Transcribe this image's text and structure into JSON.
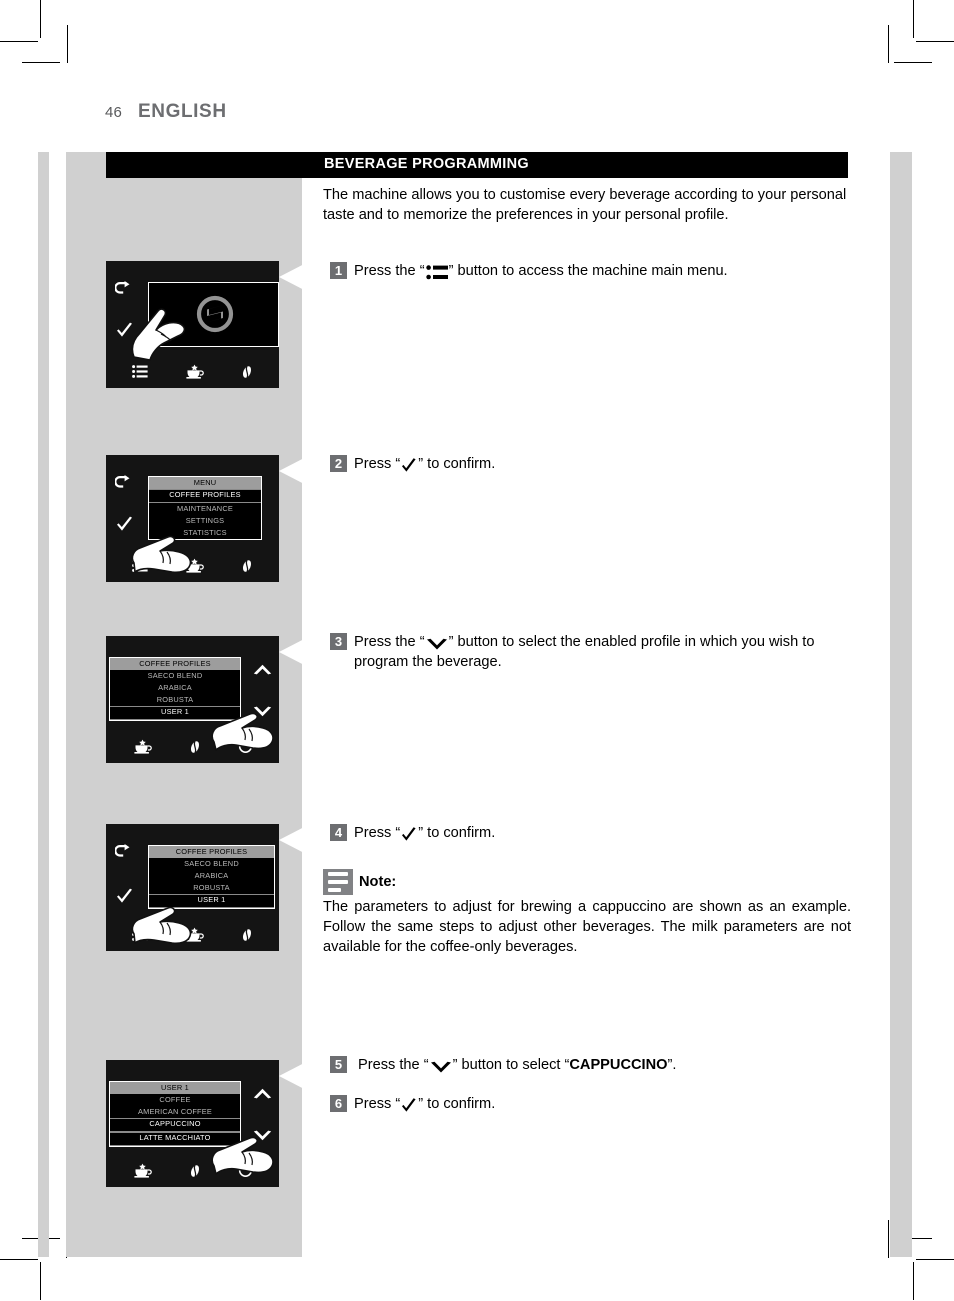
{
  "header": {
    "page_number": "46",
    "language": "ENGLISH"
  },
  "section": {
    "title": "BEVERAGE PROGRAMMING",
    "intro": "The machine allows you to customise every beverage according to your personal taste and to memorize the preferences in your personal profile."
  },
  "steps": [
    {
      "num": "1",
      "pre": "Press the “",
      "icon": "menu-lines-icon",
      "post": "” button to access the machine main menu."
    },
    {
      "num": "2",
      "pre": "Press “",
      "icon": "check-icon",
      "post": "” to confirm."
    },
    {
      "num": "3",
      "pre": "Press the “",
      "icon": "chevron-down-icon",
      "post": "” button to select the enabled profile in which you wish to program the beverage."
    },
    {
      "num": "4",
      "pre": "Press “",
      "icon": "check-icon",
      "post": "” to confirm."
    },
    {
      "num": "5",
      "pre": "Press the “",
      "icon": "chevron-down-icon",
      "post": "” button to select “",
      "emphasis": "CAPPUCCINO",
      "tail": "”."
    },
    {
      "num": "6",
      "pre": "Press “",
      "icon": "check-icon",
      "post": "” to confirm."
    }
  ],
  "note": {
    "title": "Note:",
    "body": "The parameters to adjust for brewing a cappuccino are shown as an example. Follow the same steps to adjust other beverages. The milk parameters are not available for the coffee-only beverages."
  },
  "displays": [
    {
      "id": "display-home",
      "logo": "saeco-logo",
      "side_icons": [
        "back-arrow-icon",
        "check-icon"
      ],
      "bottom_icons": [
        "menu-lines-icon",
        "cup-icon",
        "coffee-bean-icon"
      ]
    },
    {
      "id": "display-main-menu",
      "menu_title": "MENU",
      "items": [
        "COFFEE PROFILES",
        "MAINTENANCE",
        "SETTINGS",
        "STATISTICS"
      ],
      "selected": "COFFEE PROFILES",
      "side_icons": [
        "back-arrow-icon",
        "check-icon"
      ],
      "bottom_icons": [
        "menu-lines-icon",
        "cup-icon",
        "coffee-bean-icon"
      ]
    },
    {
      "id": "display-coffee-profiles-scroll",
      "menu_title": "COFFEE PROFILES",
      "items": [
        "SAECO BLEND",
        "ARABICA",
        "ROBUSTA",
        "USER 1"
      ],
      "selected": "USER 1",
      "side_icons": [
        "chevron-up-icon",
        "chevron-down-icon"
      ],
      "bottom_icons": [
        "cup-icon",
        "coffee-bean-icon",
        "power-icon"
      ]
    },
    {
      "id": "display-coffee-profiles-confirm",
      "menu_title": "COFFEE PROFILES",
      "items": [
        "SAECO BLEND",
        "ARABICA",
        "ROBUSTA",
        "USER 1"
      ],
      "selected": "USER 1",
      "side_icons": [
        "back-arrow-icon",
        "check-icon"
      ],
      "bottom_icons": [
        "menu-lines-icon",
        "cup-icon",
        "coffee-bean-icon"
      ]
    },
    {
      "id": "display-user1-beverages",
      "menu_title": "USER 1",
      "items": [
        "COFFEE",
        "AMERICAN COFFEE",
        "CAPPUCCINO",
        "LATTE MACCHIATO"
      ],
      "selected": "CAPPUCCINO",
      "side_icons": [
        "chevron-up-icon",
        "chevron-down-icon"
      ],
      "bottom_icons": [
        "cup-icon",
        "coffee-bean-icon",
        "power-icon"
      ]
    }
  ],
  "colors": {
    "panel_gray": "#d0d0d0",
    "badge_gray": "#6d6e71",
    "bar_black": "#000000",
    "menu_header_gray": "#9d9d9d"
  }
}
